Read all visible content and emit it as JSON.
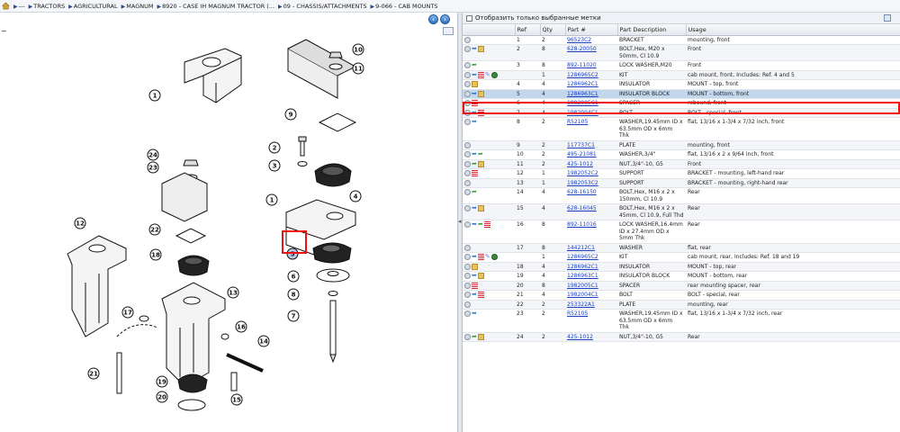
{
  "breadcrumb": [
    "---",
    "TRACTORS",
    "AGRICULTURAL",
    "MAGNUM",
    "8920 - CASE IH MAGNUM TRACTOR (...",
    "09 - CHASSIS/ATTACHMENTS",
    "9-066 - CAB MOUNTS"
  ],
  "diagram": {
    "callouts": [
      "1",
      "2",
      "3",
      "4",
      "5",
      "6",
      "7",
      "8",
      "9",
      "10",
      "11",
      "12",
      "13",
      "14",
      "15",
      "16",
      "17",
      "18",
      "19",
      "20",
      "21",
      "22",
      "23",
      "24"
    ],
    "minus": "−"
  },
  "panel": {
    "checkbox_label": "Отобразить только выбранные метки"
  },
  "table": {
    "headers": [
      "",
      "Ref",
      "Qty",
      "Part #",
      "Part Description",
      "Usage"
    ],
    "rows": [
      {
        "icons": [
          "circ"
        ],
        "ref": "1",
        "qty": "2",
        "part": "96523C2",
        "desc": "BRACKET",
        "usage": "mounting, front"
      },
      {
        "icons": [
          "circ",
          "arrow",
          "box"
        ],
        "ref": "2",
        "qty": "8",
        "part": "628-20050",
        "desc": "BOLT,Hex, M20 x 50mm, Cl 10.9",
        "usage": "Front"
      },
      {
        "icons": [
          "circ",
          "green"
        ],
        "ref": "3",
        "qty": "8",
        "part": "892-11020",
        "desc": "LOCK WASHER,M20",
        "usage": "Front"
      },
      {
        "icons": [
          "circ",
          "arrow",
          "list",
          "pen",
          "globe"
        ],
        "ref": "",
        "qty": "1",
        "part": "1286965C2",
        "desc": "KIT",
        "usage": "cab mount, front, Includes: Ref. 4 and 5"
      },
      {
        "icons": [
          "circ",
          "box"
        ],
        "ref": "4",
        "qty": "4",
        "part": "1286962C1",
        "desc": "INSULATOR",
        "usage": "MOUNT - top, front"
      },
      {
        "icons": [
          "circ",
          "arrow",
          "box"
        ],
        "ref": "5",
        "qty": "4",
        "part": "1286963C1",
        "desc": "INSULATOR BLOCK",
        "usage": "MOUNT - bottom, front",
        "selected": true
      },
      {
        "icons": [
          "circ",
          "list"
        ],
        "ref": "6",
        "qty": "4",
        "part": "1982005C1",
        "desc": "SPACER",
        "usage": "rebound, front"
      },
      {
        "icons": [
          "circ",
          "arrow",
          "list"
        ],
        "ref": "7",
        "qty": "4",
        "part": "1982004C1",
        "desc": "BOLT",
        "usage": "BOLT - special, front"
      },
      {
        "icons": [
          "circ",
          "arrow"
        ],
        "ref": "8",
        "qty": "2",
        "part": "R52105",
        "desc": "WASHER,19.45mm ID x 63.5mm OD x 6mm Thk",
        "usage": "flat, 13/16 x 1-3/4 x 7/32 inch, front"
      },
      {
        "icons": [
          "circ"
        ],
        "ref": "9",
        "qty": "2",
        "part": "117737C1",
        "desc": "PLATE",
        "usage": "mounting, front"
      },
      {
        "icons": [
          "circ",
          "arrow",
          "green"
        ],
        "ref": "10",
        "qty": "2",
        "part": "495-21081",
        "desc": "WASHER,3/4\"",
        "usage": "flat, 13/16 x 2 x 9/64 inch, front"
      },
      {
        "icons": [
          "circ",
          "green",
          "box"
        ],
        "ref": "11",
        "qty": "2",
        "part": "425-1012",
        "desc": "NUT,3/4\"-10, G5",
        "usage": "Front"
      },
      {
        "icons": [
          "circ",
          "list"
        ],
        "ref": "12",
        "qty": "1",
        "part": "1982052C2",
        "desc": "SUPPORT",
        "usage": "BRACKET - mounting, left-hand rear"
      },
      {
        "icons": [
          "circ"
        ],
        "ref": "13",
        "qty": "1",
        "part": "1982053C2",
        "desc": "SUPPORT",
        "usage": "BRACKET - mounting, right-hand rear"
      },
      {
        "icons": [
          "circ",
          "green"
        ],
        "ref": "14",
        "qty": "4",
        "part": "628-16150",
        "desc": "BOLT,Hex, M16 x 2 x 150mm, Cl 10.9",
        "usage": "Rear"
      },
      {
        "icons": [
          "circ",
          "arrow",
          "box"
        ],
        "ref": "15",
        "qty": "4",
        "part": "628-16045",
        "desc": "BOLT,Hex, M16 x 2 x 45mm, Cl 10.9, Full Thd",
        "usage": "Rear"
      },
      {
        "icons": [
          "circ",
          "arrow",
          "green",
          "list"
        ],
        "ref": "16",
        "qty": "8",
        "part": "892-11016",
        "desc": "LOCK WASHER,16.4mm ID x 27.4mm OD x 5mm Thk",
        "usage": "Rear"
      },
      {
        "icons": [
          "circ"
        ],
        "ref": "17",
        "qty": "8",
        "part": "144212C1",
        "desc": "WASHER",
        "usage": "flat, rear"
      },
      {
        "icons": [
          "circ",
          "arrow",
          "list",
          "pen",
          "globe"
        ],
        "ref": "",
        "qty": "1",
        "part": "1286965C2",
        "desc": "KIT",
        "usage": "cab mount, rear, Includes: Ref. 18 and 19"
      },
      {
        "icons": [
          "circ",
          "box"
        ],
        "ref": "18",
        "qty": "4",
        "part": "1286962C1",
        "desc": "INSULATOR",
        "usage": "MOUNT - top, rear"
      },
      {
        "icons": [
          "circ",
          "arrow",
          "box"
        ],
        "ref": "19",
        "qty": "4",
        "part": "1286963C1",
        "desc": "INSULATOR BLOCK",
        "usage": "MOUNT - bottom, rear"
      },
      {
        "icons": [
          "circ",
          "list"
        ],
        "ref": "20",
        "qty": "8",
        "part": "1982005C1",
        "desc": "SPACER",
        "usage": "rear mounting spacer, rear"
      },
      {
        "icons": [
          "circ",
          "arrow",
          "list"
        ],
        "ref": "21",
        "qty": "4",
        "part": "1982004C1",
        "desc": "BOLT",
        "usage": "BOLT - special, rear"
      },
      {
        "icons": [
          "circ"
        ],
        "ref": "22",
        "qty": "2",
        "part": "253322A1",
        "desc": "PLATE",
        "usage": "mounting, rear"
      },
      {
        "icons": [
          "circ",
          "arrow"
        ],
        "ref": "23",
        "qty": "2",
        "part": "R52105",
        "desc": "WASHER,19.45mm ID x 63.5mm OD x 6mm Thk",
        "usage": "flat, 13/16 x 1-3/4 x 7/32 inch, rear"
      },
      {
        "icons": [
          "circ",
          "green",
          "box"
        ],
        "ref": "24",
        "qty": "2",
        "part": "425-1012",
        "desc": "NUT,3/4\"-10, G5",
        "usage": "Rear"
      }
    ]
  }
}
